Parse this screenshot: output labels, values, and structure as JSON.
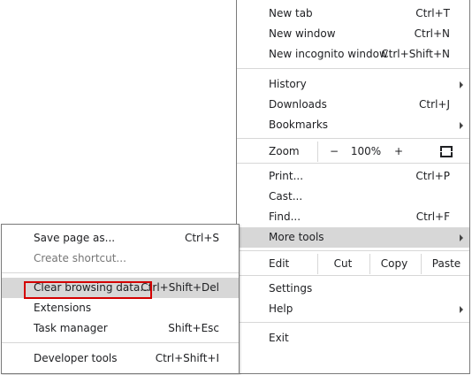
{
  "main_menu": {
    "new_tab": {
      "label": "New tab",
      "shortcut": "Ctrl+T"
    },
    "new_window": {
      "label": "New window",
      "shortcut": "Ctrl+N"
    },
    "new_incognito": {
      "label": "New incognito window",
      "shortcut": "Ctrl+Shift+N"
    },
    "history": {
      "label": "History"
    },
    "downloads": {
      "label": "Downloads",
      "shortcut": "Ctrl+J"
    },
    "bookmarks": {
      "label": "Bookmarks"
    },
    "zoom": {
      "label": "Zoom",
      "minus": "−",
      "value": "100%",
      "plus": "+"
    },
    "print": {
      "label": "Print...",
      "shortcut": "Ctrl+P"
    },
    "cast": {
      "label": "Cast..."
    },
    "find": {
      "label": "Find...",
      "shortcut": "Ctrl+F"
    },
    "more_tools": {
      "label": "More tools"
    },
    "edit": {
      "label": "Edit",
      "cut": "Cut",
      "copy": "Copy",
      "paste": "Paste"
    },
    "settings": {
      "label": "Settings"
    },
    "help": {
      "label": "Help"
    },
    "exit": {
      "label": "Exit"
    }
  },
  "sub_menu": {
    "save_page": {
      "label": "Save page as...",
      "shortcut": "Ctrl+S"
    },
    "create_shortcut": {
      "label": "Create shortcut..."
    },
    "clear_browsing": {
      "label": "Clear browsing data...",
      "shortcut": "Ctrl+Shift+Del"
    },
    "extensions": {
      "label": "Extensions"
    },
    "task_manager": {
      "label": "Task manager",
      "shortcut": "Shift+Esc"
    },
    "developer_tools": {
      "label": "Developer tools",
      "shortcut": "Ctrl+Shift+I"
    }
  },
  "colors": {
    "highlight": "#d7d7d7",
    "focus_box": "#d40000"
  },
  "icons": {
    "submenu_arrow": "chevron-right-icon",
    "fullscreen": "fullscreen-icon"
  }
}
